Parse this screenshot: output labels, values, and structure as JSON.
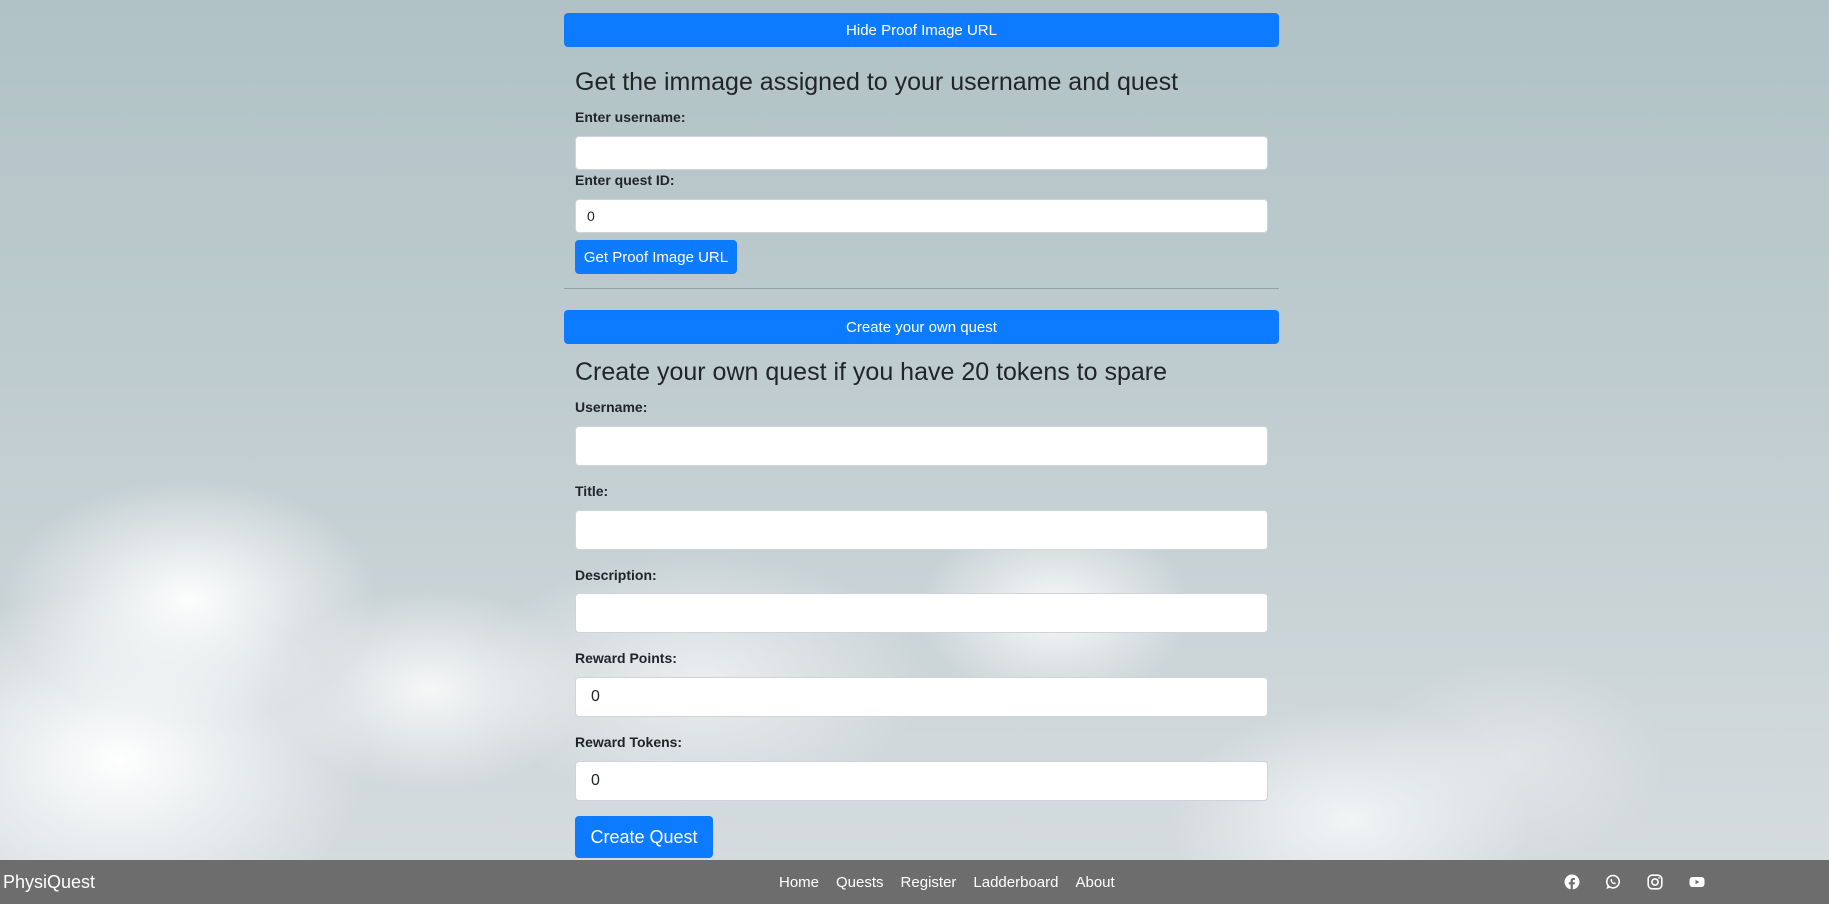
{
  "proof_section": {
    "toggle_label": "Hide Proof Image URL",
    "title": "Get the immage assigned to your username and quest",
    "username_label": "Enter username:",
    "username_value": "",
    "quest_id_label": "Enter quest ID:",
    "quest_id_value": "0",
    "submit_label": "Get Proof Image URL"
  },
  "create_section": {
    "toggle_label": "Create your own quest",
    "title": "Create your own quest if you have 20 tokens to spare",
    "username_label": "Username:",
    "username_value": "",
    "title_label": "Title:",
    "title_value": "",
    "description_label": "Description:",
    "description_value": "",
    "reward_points_label": "Reward Points:",
    "reward_points_value": "0",
    "reward_tokens_label": "Reward Tokens:",
    "reward_tokens_value": "0",
    "submit_label": "Create Quest"
  },
  "footer": {
    "brand": "PhysiQuest",
    "links": [
      "Home",
      "Quests",
      "Register",
      "Ladderboard",
      "About"
    ],
    "social_icons": [
      "facebook-icon",
      "whatsapp-icon",
      "instagram-icon",
      "youtube-icon"
    ]
  },
  "colors": {
    "accent": "#0d7bff",
    "footer_background": "#6e6d6d",
    "text": "#212529"
  }
}
